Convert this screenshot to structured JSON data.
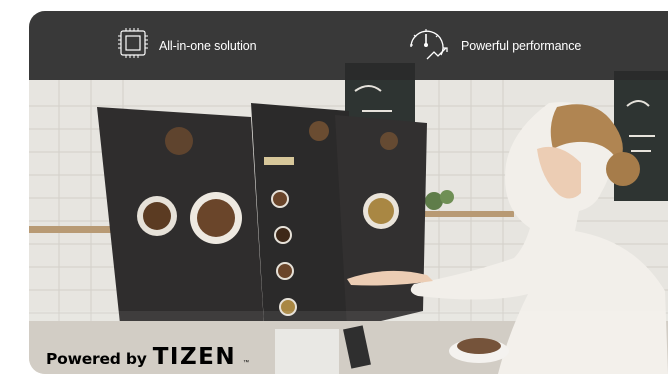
{
  "features": [
    {
      "label": "All-in-one solution",
      "icon": "chip-icon"
    },
    {
      "label": "Powerful performance",
      "icon": "speedometer-icon"
    }
  ],
  "badge": {
    "prefix": "Powered by",
    "brand": "TIZEN",
    "mark": "™"
  },
  "colors": {
    "bar": "#2a2a2a",
    "text": "#ffffff"
  }
}
